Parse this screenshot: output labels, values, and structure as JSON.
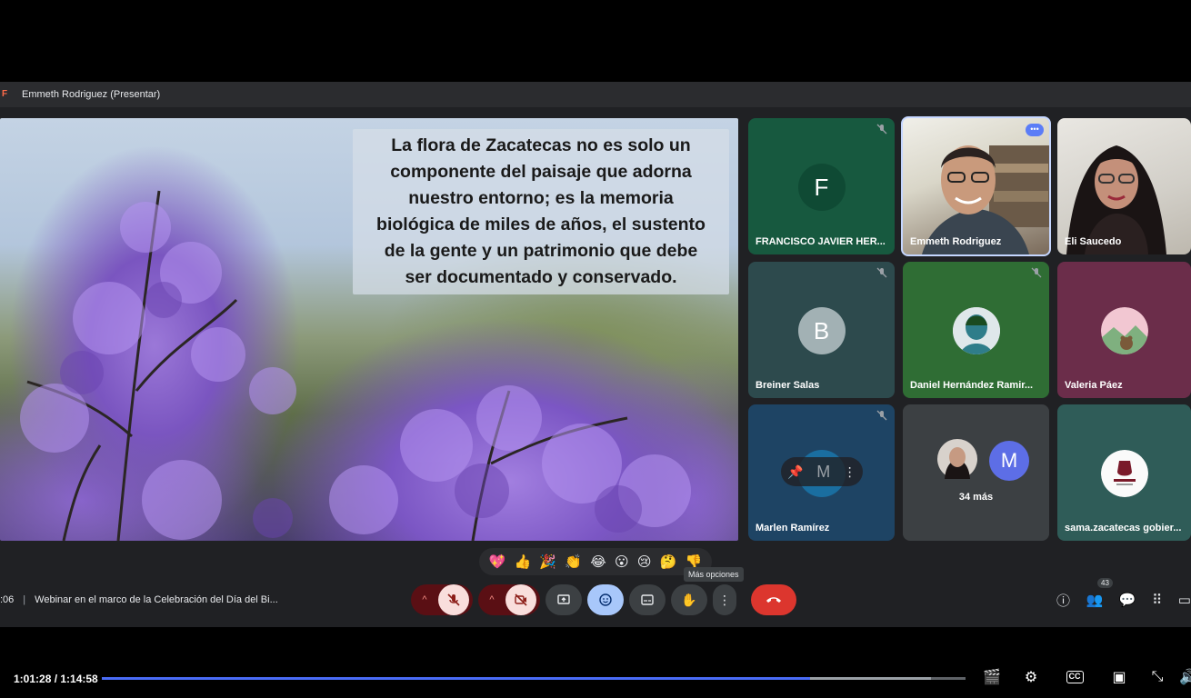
{
  "presenter_bar": {
    "label": "Emmeth Rodriguez (Presentar)"
  },
  "slide": {
    "quote_lines": [
      "La flora de Zacatecas no es solo un",
      "componente del paisaje que adorna",
      "nuestro entorno; es la memoria",
      "biológica de miles de años, el sustento",
      "de la gente y un patrimonio que debe",
      "ser documentado y conservado."
    ]
  },
  "participants": [
    {
      "name": "FRANCISCO JAVIER HER...",
      "initial": "F",
      "avatar_color": "#0f4a34",
      "muted": true
    },
    {
      "name": "Emmeth Rodriguez",
      "speaking": true
    },
    {
      "name": "Eli Saucedo"
    },
    {
      "name": "Breiner Salas",
      "initial": "B",
      "avatar_color": "#a2b1b4",
      "muted": true
    },
    {
      "name": "Daniel Hernández Ramir...",
      "muted": true
    },
    {
      "name": "Valeria Páez"
    },
    {
      "name": "Marlen Ramírez",
      "initial": "M",
      "muted": true
    },
    {
      "name": "34 más",
      "initial": "M",
      "avatar_color": "#5d6ee6"
    },
    {
      "name": "sama.zacatecas gobier..."
    }
  ],
  "reactions": [
    "💖",
    "👍",
    "🎉",
    "👏",
    "😂",
    "😮",
    "😢",
    "🤔",
    "👎"
  ],
  "tooltip": "Más opciones",
  "meeting": {
    "clock": ":06",
    "title": "Webinar en el marco de la Celebración del Día del Bi..."
  },
  "participant_count": "43",
  "player": {
    "time_display": "1:01:28 / 1:14:58",
    "progress": 0.82,
    "buffered": 0.96,
    "cc_label": "CC"
  },
  "icons": {
    "mic_off": "mic-off-icon",
    "cam_off": "cam-off-icon",
    "present": "present-icon",
    "emoji": "emoji-icon",
    "captions": "captions-icon",
    "hand": "raise-hand-icon",
    "more": "more-vert-icon",
    "end": "end-call-icon"
  }
}
